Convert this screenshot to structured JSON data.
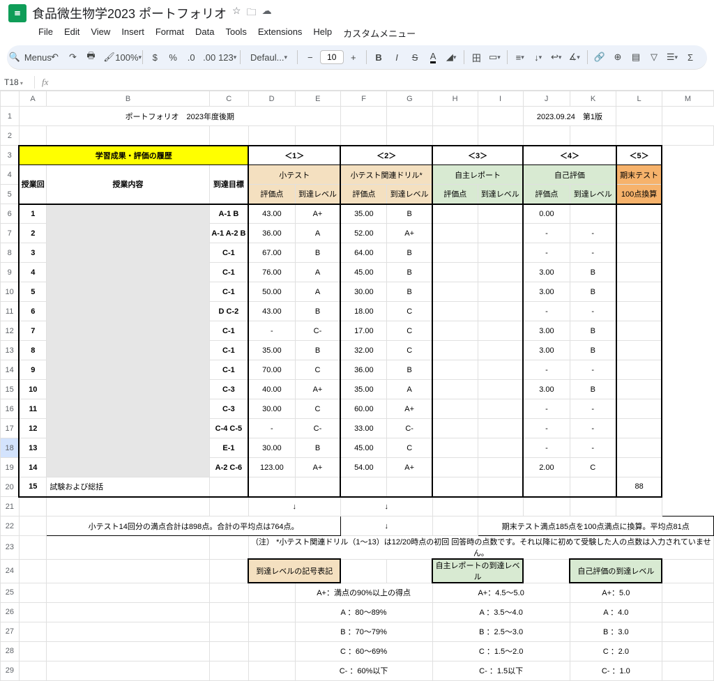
{
  "doc": {
    "title": "食品微生物学2023 ポートフォリオ"
  },
  "menu": [
    "File",
    "Edit",
    "View",
    "Insert",
    "Format",
    "Data",
    "Tools",
    "Extensions",
    "Help",
    "カスタムメニュー"
  ],
  "toolbar": {
    "search_label": "Menus",
    "zoom": "100%",
    "font": "Defaul...",
    "size": "10"
  },
  "name_box": "T18",
  "colhdrs": [
    "A",
    "B",
    "C",
    "D",
    "E",
    "F",
    "G",
    "H",
    "I",
    "J",
    "K",
    "L",
    "M"
  ],
  "title": "ポートフォリオ　2023年度後期",
  "version": "2023.09.24　第1版",
  "section_title": "学習成果・評価の履歴",
  "group_hdrs": {
    "c1": "＜1＞",
    "c2": "＜2＞",
    "c3": "＜3＞",
    "c4": "＜4＞",
    "c5": "＜5＞"
  },
  "sub1": {
    "c1": "小テスト",
    "c2": "小テスト関連ドリル*",
    "c3": "自主レポート",
    "c4": "自己評価",
    "c5": "期末テスト"
  },
  "hdrA": "授業回",
  "hdrB": "授業内容",
  "hdrC": "到達目標",
  "eval": "評価点",
  "level": "到達レベル",
  "conv": "100点換算",
  "rows": [
    {
      "n": "1",
      "g": "A-1 B",
      "d": "43.00",
      "e": "A+",
      "f": "35.00",
      "gg": "B",
      "j": "0.00",
      "k": ""
    },
    {
      "n": "2",
      "g": "A-1 A-2 B",
      "d": "36.00",
      "e": "A",
      "f": "52.00",
      "gg": "A+",
      "j": "-",
      "k": "-"
    },
    {
      "n": "3",
      "g": "C-1",
      "d": "67.00",
      "e": "B",
      "f": "64.00",
      "gg": "B",
      "j": "-",
      "k": "-"
    },
    {
      "n": "4",
      "g": "C-1",
      "d": "76.00",
      "e": "A",
      "f": "45.00",
      "gg": "B",
      "j": "3.00",
      "k": "B"
    },
    {
      "n": "5",
      "g": "C-1",
      "d": "50.00",
      "e": "A",
      "f": "30.00",
      "gg": "B",
      "j": "3.00",
      "k": "B"
    },
    {
      "n": "6",
      "g": "D C-2",
      "d": "43.00",
      "e": "B",
      "f": "18.00",
      "gg": "C",
      "j": "-",
      "k": "-"
    },
    {
      "n": "7",
      "g": "C-1",
      "d": "-",
      "e": "C-",
      "f": "17.00",
      "gg": "C",
      "j": "3.00",
      "k": "B"
    },
    {
      "n": "8",
      "g": "C-1",
      "d": "35.00",
      "e": "B",
      "f": "32.00",
      "gg": "C",
      "j": "3.00",
      "k": "B"
    },
    {
      "n": "9",
      "g": "C-1",
      "d": "70.00",
      "e": "C",
      "f": "36.00",
      "gg": "B",
      "j": "-",
      "k": "-"
    },
    {
      "n": "10",
      "g": "C-3",
      "d": "40.00",
      "e": "A+",
      "f": "35.00",
      "gg": "A",
      "j": "3.00",
      "k": "B"
    },
    {
      "n": "11",
      "g": "C-3",
      "d": "30.00",
      "e": "C",
      "f": "60.00",
      "gg": "A+",
      "j": "-",
      "k": "-"
    },
    {
      "n": "12",
      "g": "C-4 C-5",
      "d": "-",
      "e": "C-",
      "f": "33.00",
      "gg": "C-",
      "j": "-",
      "k": "-"
    },
    {
      "n": "13",
      "g": "E-1",
      "d": "30.00",
      "e": "B",
      "f": "45.00",
      "gg": "C",
      "j": "-",
      "k": "-"
    },
    {
      "n": "14",
      "g": "A-2 C-6",
      "d": "123.00",
      "e": "A+",
      "f": "54.00",
      "gg": "A+",
      "j": "2.00",
      "k": "C"
    }
  ],
  "last": {
    "n": "15",
    "b": "試験および総括",
    "m": "88"
  },
  "arrow": "↓",
  "box1": "小テスト14回分の満点合計は898点。合計の平均点は764点。",
  "box2": "期末テスト満点185点を100点満点に換算。平均点81点",
  "footnote": "（注）   *小テスト関連ドリル（1〜13）は12/20時点の初回 回答時の点数です。それ以降に初めて受験した人の点数は入力されていません。",
  "lg1": "到達レベルの記号表記",
  "lg2": "自主レポートの到達レベル",
  "lg3": "自己評価の到達レベル",
  "legend1": [
    "A+：満点の90%以上の得点",
    "A ：80〜89%",
    "B ：70〜79%",
    "C ：60〜69%",
    "C- ：60%以下"
  ],
  "legend2": [
    "A+：4.5〜5.0",
    "A ：3.5〜4.0",
    "B ：2.5〜3.0",
    "C ：1.5〜2.0",
    "C- ：1.5以下"
  ],
  "legend3": [
    "A+：5.0",
    "A ：4.0",
    "B ：3.0",
    "C ：2.0",
    "C- ：1.0"
  ]
}
